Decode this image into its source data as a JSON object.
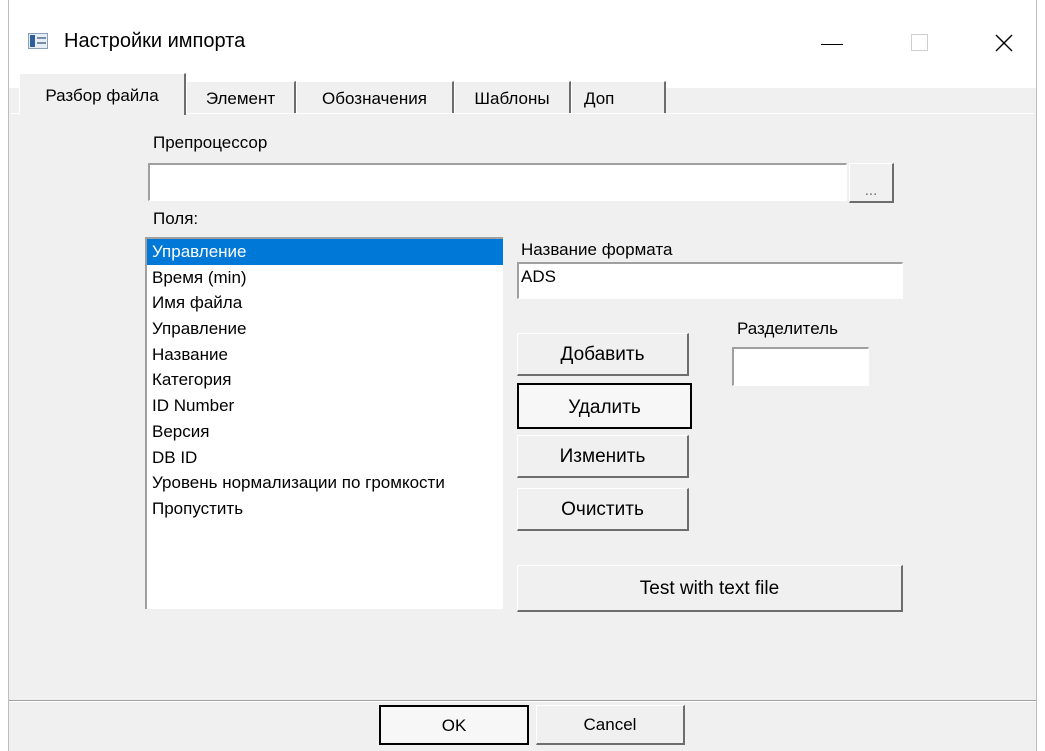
{
  "window": {
    "title": "Настройки импорта",
    "icon": "app-window-icon"
  },
  "tabs": [
    {
      "label": "Разбор файла",
      "active": true
    },
    {
      "label": "Элемент",
      "active": false
    },
    {
      "label": "Обозначения",
      "active": false
    },
    {
      "label": "Шаблоны",
      "active": false
    },
    {
      "label": "Доп",
      "active": false
    }
  ],
  "preprocessor": {
    "label": "Препроцессор",
    "value": "",
    "browse_label": "..."
  },
  "fields": {
    "label": "Поля:",
    "items": [
      "Управление",
      "Время (min)",
      "Имя файла",
      "Управление",
      "Название",
      "Категория",
      "ID Number",
      "Версия",
      "DB ID",
      "Уровень нормализации по громкости",
      "Пропустить"
    ],
    "selected_index": 0
  },
  "format": {
    "label": "Название формата",
    "value": "ADS"
  },
  "separator": {
    "label": "Разделитель",
    "value": ""
  },
  "buttons": {
    "add": "Добавить",
    "delete": "Удалить",
    "edit": "Изменить",
    "clear": "Очистить",
    "test": "Test with text file",
    "ok": "OK",
    "cancel": "Cancel"
  },
  "colors": {
    "selection": "#0078d7",
    "dialog_bg": "#f0f0f0"
  }
}
